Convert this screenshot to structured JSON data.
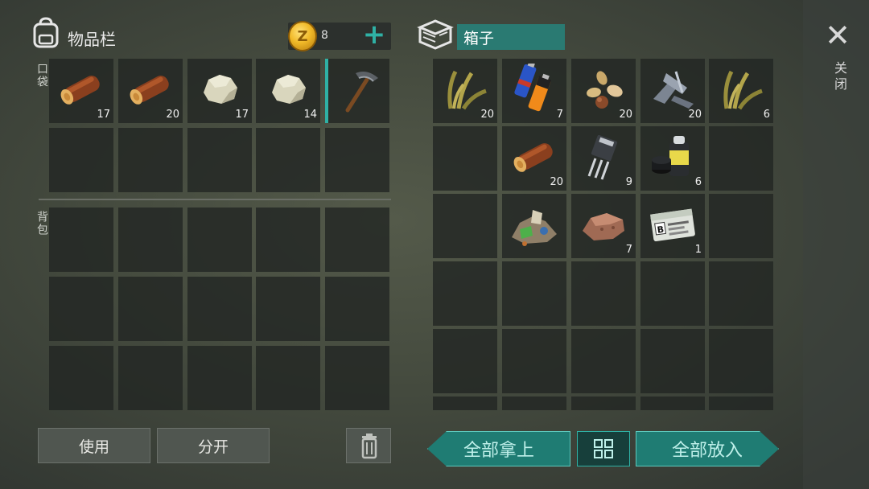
{
  "inventory": {
    "title": "物品栏",
    "coins": "8",
    "pocket_label": "口袋",
    "backpack_label": "背包",
    "pocket_slots": [
      {
        "item": "wood-log",
        "qty": "17"
      },
      {
        "item": "wood-log",
        "qty": "20"
      },
      {
        "item": "stone",
        "qty": "17"
      },
      {
        "item": "stone",
        "qty": "14"
      },
      {
        "item": "pickaxe",
        "qty": ""
      }
    ]
  },
  "box": {
    "title": "箱子",
    "slots": [
      {
        "item": "plant-fiber",
        "qty": "20"
      },
      {
        "item": "batteries",
        "qty": "7"
      },
      {
        "item": "seeds",
        "qty": "20"
      },
      {
        "item": "metal-scrap",
        "qty": "20"
      },
      {
        "item": "plant-fiber",
        "qty": "6"
      },
      {
        "item": "",
        "qty": ""
      },
      {
        "item": "wood-log",
        "qty": "20"
      },
      {
        "item": "transistor",
        "qty": "9"
      },
      {
        "item": "spray-paint",
        "qty": "6"
      },
      {
        "item": "",
        "qty": ""
      },
      {
        "item": "",
        "qty": ""
      },
      {
        "item": "ore-pile",
        "qty": ""
      },
      {
        "item": "copper-ore",
        "qty": "7"
      },
      {
        "item": "army-id-card",
        "qty": "1"
      },
      {
        "item": "",
        "qty": ""
      }
    ]
  },
  "buttons": {
    "use": "使用",
    "split": "分开",
    "take_all": "全部拿上",
    "put_all": "全部放入",
    "close": "关闭"
  },
  "colors": {
    "accent": "#2fb1a5",
    "coin": "#f1b928"
  }
}
